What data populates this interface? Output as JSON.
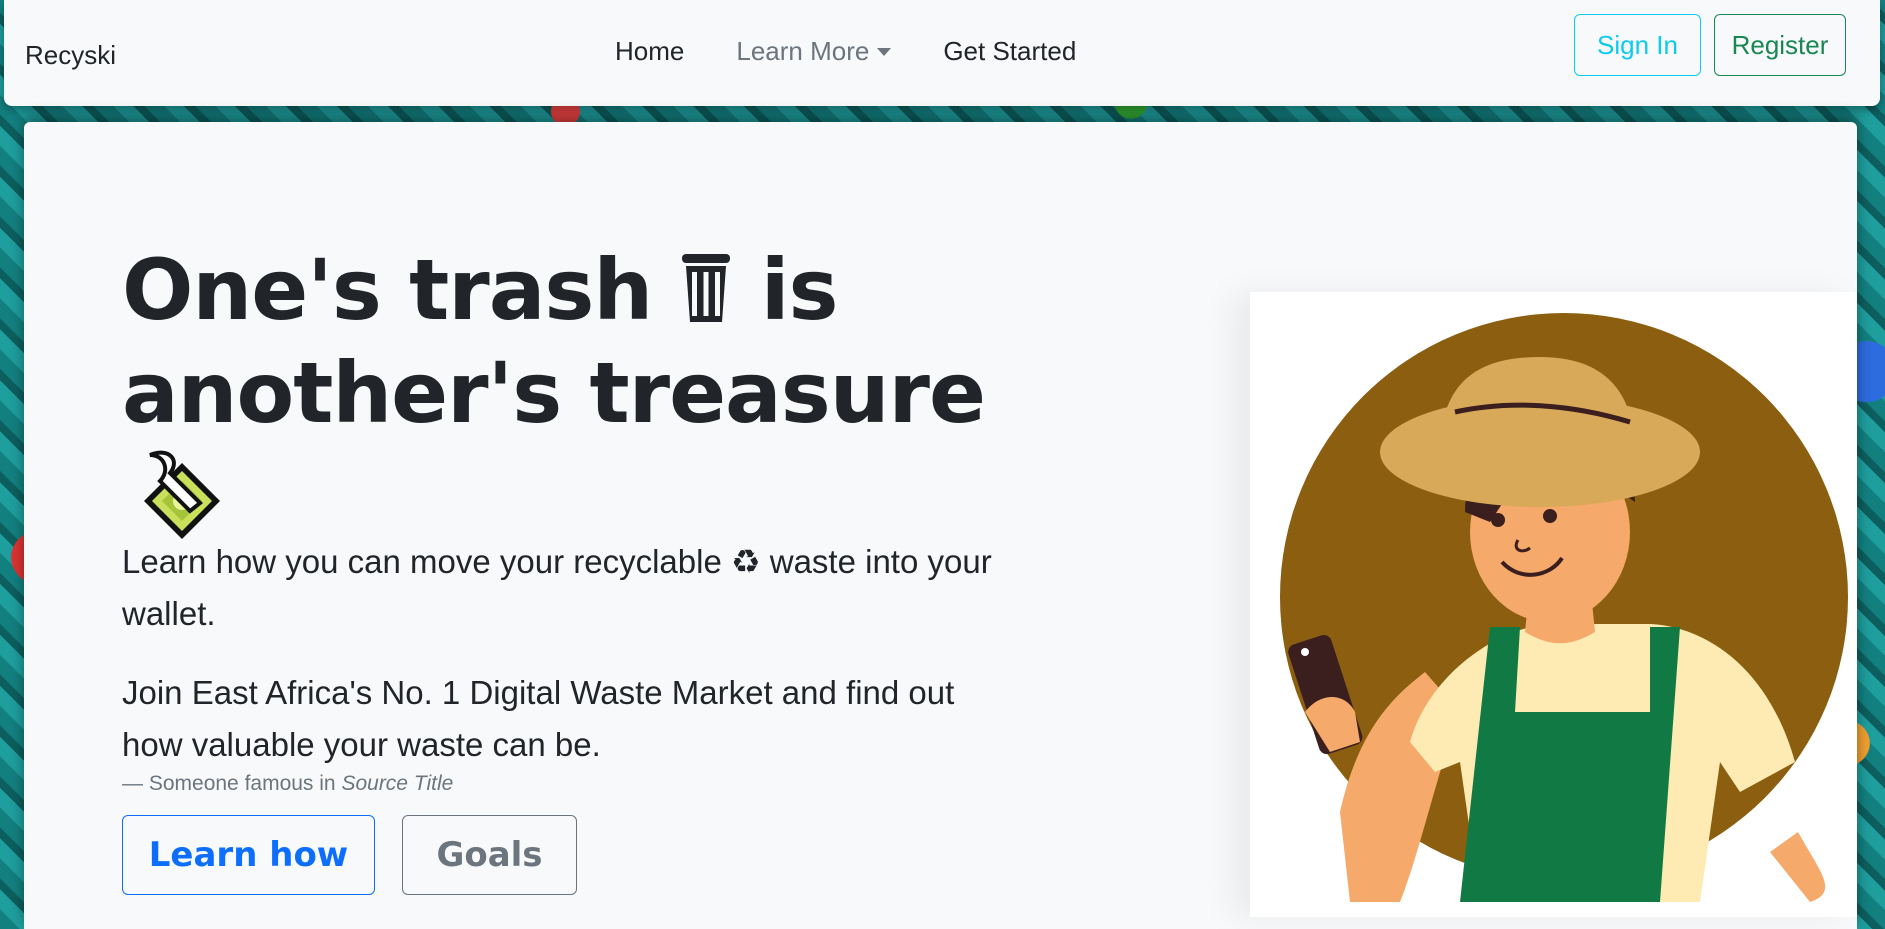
{
  "brand": "Recyski",
  "nav": {
    "links": [
      "Home",
      "Learn More",
      "Get Started"
    ],
    "sign_in": "Sign In",
    "register": "Register"
  },
  "hero": {
    "headline_part1": "One's trash",
    "headline_part2": "is another's treasure",
    "lead": "Learn how you can move your recyclable ♻ waste into your wallet.",
    "quote": "Join East Africa's No. 1 Digital Waste Market and find out how valuable your waste can be.",
    "quote_author": "— Someone famous in",
    "quote_source": "Source Title",
    "primary_button": "Learn how",
    "secondary_button": "Goals"
  },
  "icons": {
    "trash": "wastebasket-icon",
    "money": "money-with-wings-icon",
    "recycle": "recycle-icon",
    "caret": "caret-down-icon"
  },
  "colors": {
    "primary": "#0d6efd",
    "info": "#0dcaf0",
    "success": "#198754",
    "secondary": "#6c757d",
    "illustration_circle": "#8b5e10",
    "apron": "#117a44"
  }
}
